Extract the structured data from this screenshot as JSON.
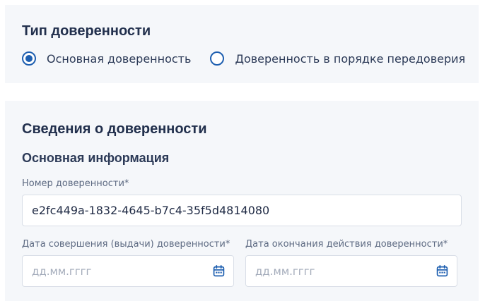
{
  "poa_type": {
    "title": "Тип доверенности",
    "options": [
      {
        "label": "Основная доверенность",
        "selected": true
      },
      {
        "label": "Доверенность в порядке передоверия",
        "selected": false
      }
    ]
  },
  "poa_info": {
    "title": "Сведения о доверенности",
    "subtitle": "Основная информация",
    "number": {
      "label": "Номер доверенности*",
      "value": "e2fc449a-1832-4645-b7c4-35f5d4814080"
    },
    "issue_date": {
      "label": "Дата совершения (выдачи) доверенности*",
      "placeholder": "дд.мм.гггг"
    },
    "end_date": {
      "label": "Дата окончания действия доверенности*",
      "placeholder": "дд.мм.гггг"
    }
  },
  "colors": {
    "accent": "#1e5fb0",
    "card_bg": "#f5f7fa"
  }
}
